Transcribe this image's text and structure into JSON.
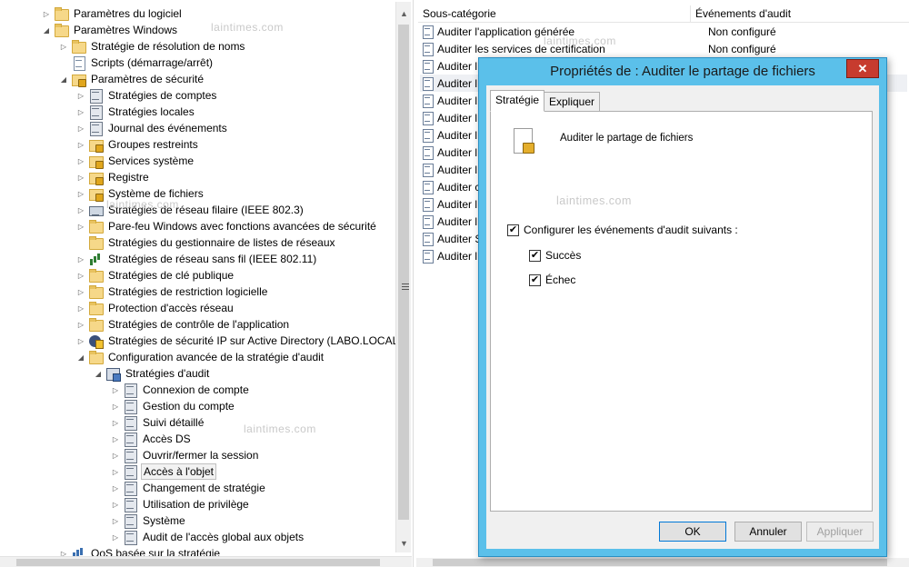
{
  "tree": {
    "items": [
      {
        "label": "Paramètres du logiciel"
      },
      {
        "label": "Paramètres Windows"
      },
      {
        "label": "Stratégie de résolution de noms"
      },
      {
        "label": "Scripts (démarrage/arrêt)"
      },
      {
        "label": "Paramètres de sécurité"
      },
      {
        "label": "Stratégies de comptes"
      },
      {
        "label": "Stratégies locales"
      },
      {
        "label": "Journal des événements"
      },
      {
        "label": "Groupes restreints"
      },
      {
        "label": "Services système"
      },
      {
        "label": "Registre"
      },
      {
        "label": "Système de fichiers"
      },
      {
        "label": "Stratégies de réseau filaire (IEEE 802.3)"
      },
      {
        "label": "Pare-feu Windows avec fonctions avancées de sécurité"
      },
      {
        "label": "Stratégies du gestionnaire de listes de réseaux"
      },
      {
        "label": "Stratégies de réseau sans fil (IEEE 802.11)"
      },
      {
        "label": "Stratégies de clé publique"
      },
      {
        "label": "Stratégies de restriction logicielle"
      },
      {
        "label": "Protection d'accès réseau"
      },
      {
        "label": "Stratégies de contrôle de l'application"
      },
      {
        "label": "Stratégies de sécurité IP sur Active Directory (LABO.LOCAL)"
      },
      {
        "label": "Configuration avancée de la stratégie d'audit"
      },
      {
        "label": "Stratégies d'audit"
      },
      {
        "label": "Connexion de compte"
      },
      {
        "label": "Gestion du compte"
      },
      {
        "label": "Suivi détaillé"
      },
      {
        "label": "Accès DS"
      },
      {
        "label": "Ouvrir/fermer la session"
      },
      {
        "label": "Accès à l'objet"
      },
      {
        "label": "Changement de stratégie"
      },
      {
        "label": "Utilisation de privilège"
      },
      {
        "label": "Système"
      },
      {
        "label": "Audit de l'accès global aux objets"
      },
      {
        "label": "QoS basée sur la stratégie"
      }
    ]
  },
  "list": {
    "columns": [
      "Sous-catégorie",
      "Événements d'audit"
    ],
    "rows": [
      {
        "name": "Auditer l'application générée",
        "value": "Non configuré"
      },
      {
        "name": "Auditer les services de certification",
        "value": "Non configuré"
      },
      {
        "name": "Auditer l",
        "value": ""
      },
      {
        "name": "Auditer l",
        "value": ""
      },
      {
        "name": "Auditer l",
        "value": ""
      },
      {
        "name": "Auditer l",
        "value": ""
      },
      {
        "name": "Auditer l",
        "value": ""
      },
      {
        "name": "Auditer l",
        "value": ""
      },
      {
        "name": "Auditer l",
        "value": ""
      },
      {
        "name": "Auditer c",
        "value": ""
      },
      {
        "name": "Auditer l",
        "value": ""
      },
      {
        "name": "Auditer l",
        "value": ""
      },
      {
        "name": "Auditer S",
        "value": ""
      },
      {
        "name": "Auditer l",
        "value": ""
      }
    ]
  },
  "watermark": "laintimes.com",
  "dialog": {
    "title": "Propriétés de : Auditer le partage de fichiers",
    "close_label": "✕",
    "tabs": [
      "Stratégie",
      "Expliquer"
    ],
    "policy_name": "Auditer le partage de fichiers",
    "configure_label": "Configurer les événements d'audit suivants :",
    "success_label": "Succès",
    "failure_label": "Échec",
    "configure_checked": true,
    "success_checked": true,
    "failure_checked": true,
    "check_glyph": "✔",
    "buttons": {
      "ok": "OK",
      "cancel": "Annuler",
      "apply": "Appliquer"
    }
  },
  "icons": {
    "expand": "▷",
    "collapse": "◢",
    "scroll_up": "▲",
    "scroll_down": "▼"
  }
}
